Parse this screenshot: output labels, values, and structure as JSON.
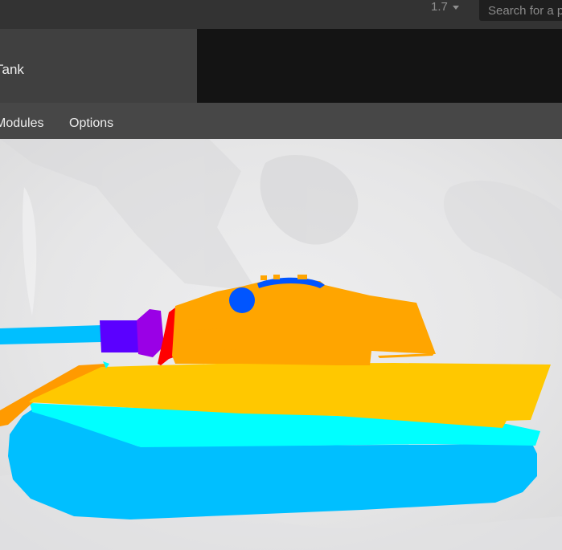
{
  "header": {
    "version": "1.7",
    "search": {
      "placeholder": "Search for a p",
      "value": ""
    }
  },
  "tank": {
    "title": "Tank"
  },
  "tabs": [
    {
      "label": "Modules"
    },
    {
      "label": "Options"
    }
  ],
  "viewer": {
    "background_color": "#e9e9ea",
    "parts": [
      {
        "name": "gun-barrel",
        "color": "#00bfff"
      },
      {
        "name": "gun-breech-purple",
        "color": "#5b00ff"
      },
      {
        "name": "gun-mantlet-violet",
        "color": "#9a00e6"
      },
      {
        "name": "mantlet-red",
        "color": "#ff0000"
      },
      {
        "name": "turret",
        "color": "#ffa500"
      },
      {
        "name": "turret-side-panels",
        "color": "#ff7f00"
      },
      {
        "name": "turret-cupola",
        "color": "#0055ff"
      },
      {
        "name": "turret-roof-details",
        "color": "#00e6e6"
      },
      {
        "name": "hull-upper",
        "color": "#ffc800"
      },
      {
        "name": "hull-front-plate",
        "color": "#ff9a00"
      },
      {
        "name": "hull-mid-cyan",
        "color": "#00ffff"
      },
      {
        "name": "hull-lower-tracks",
        "color": "#00bfff"
      }
    ]
  }
}
